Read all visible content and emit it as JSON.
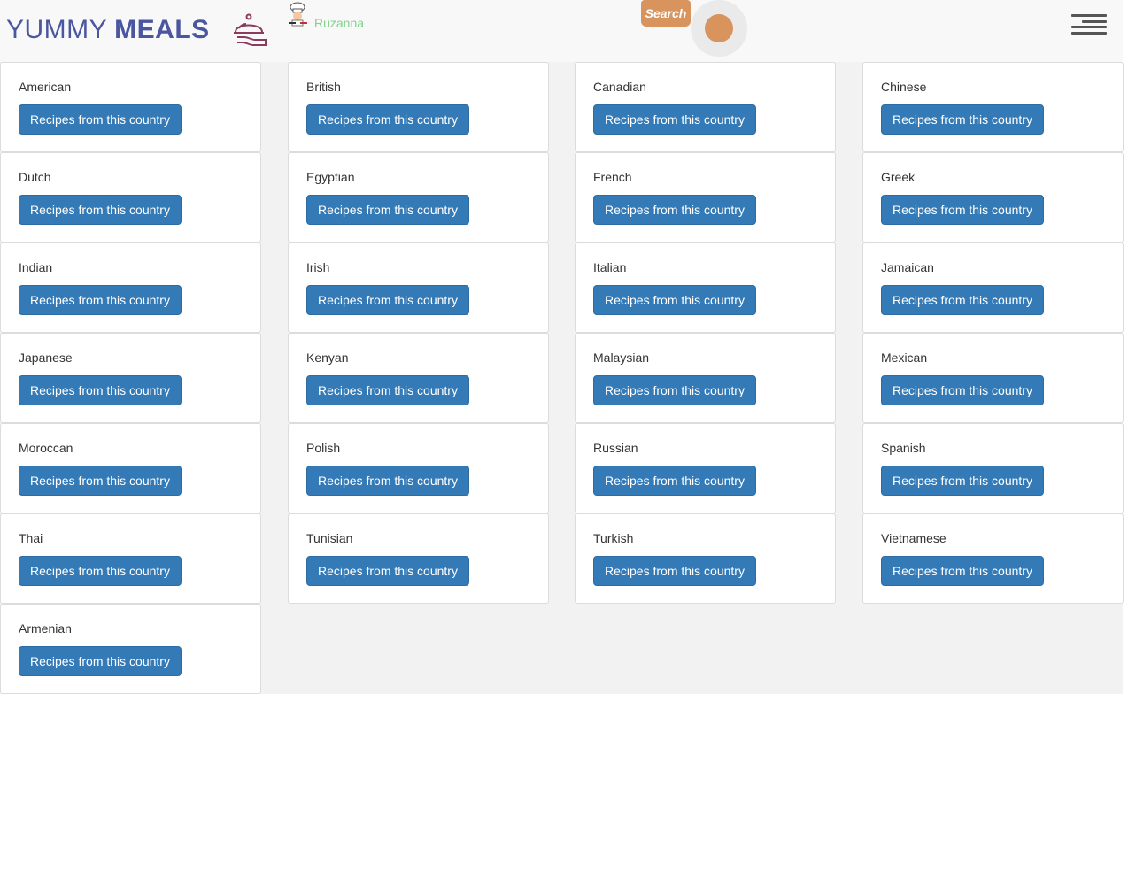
{
  "header": {
    "logo_word1": "YUMMY",
    "logo_word2": "MEALS",
    "user_name": "Ruzanna",
    "search_label": "Search"
  },
  "countries": [
    {
      "name": "American",
      "button": "Recipes from this country"
    },
    {
      "name": "British",
      "button": "Recipes from this country"
    },
    {
      "name": "Canadian",
      "button": "Recipes from this country"
    },
    {
      "name": "Chinese",
      "button": "Recipes from this country"
    },
    {
      "name": "Dutch",
      "button": "Recipes from this country"
    },
    {
      "name": "Egyptian",
      "button": "Recipes from this country"
    },
    {
      "name": "French",
      "button": "Recipes from this country"
    },
    {
      "name": "Greek",
      "button": "Recipes from this country"
    },
    {
      "name": "Indian",
      "button": "Recipes from this country"
    },
    {
      "name": "Irish",
      "button": "Recipes from this country"
    },
    {
      "name": "Italian",
      "button": "Recipes from this country"
    },
    {
      "name": "Jamaican",
      "button": "Recipes from this country"
    },
    {
      "name": "Japanese",
      "button": "Recipes from this country"
    },
    {
      "name": "Kenyan",
      "button": "Recipes from this country"
    },
    {
      "name": "Malaysian",
      "button": "Recipes from this country"
    },
    {
      "name": "Mexican",
      "button": "Recipes from this country"
    },
    {
      "name": "Moroccan",
      "button": "Recipes from this country"
    },
    {
      "name": "Polish",
      "button": "Recipes from this country"
    },
    {
      "name": "Russian",
      "button": "Recipes from this country"
    },
    {
      "name": "Spanish",
      "button": "Recipes from this country"
    },
    {
      "name": "Thai",
      "button": "Recipes from this country"
    },
    {
      "name": "Tunisian",
      "button": "Recipes from this country"
    },
    {
      "name": "Turkish",
      "button": "Recipes from this country"
    },
    {
      "name": "Vietnamese",
      "button": "Recipes from this country"
    },
    {
      "name": "Armenian",
      "button": "Recipes from this country"
    }
  ],
  "colors": {
    "brand": "#4a57a0",
    "accent": "#d9935d",
    "button": "#337ab7",
    "username": "#7fd28a"
  },
  "icons": {
    "logo": "cloche-icon",
    "avatar": "chef-icon",
    "menu": "hamburger-menu-icon"
  }
}
